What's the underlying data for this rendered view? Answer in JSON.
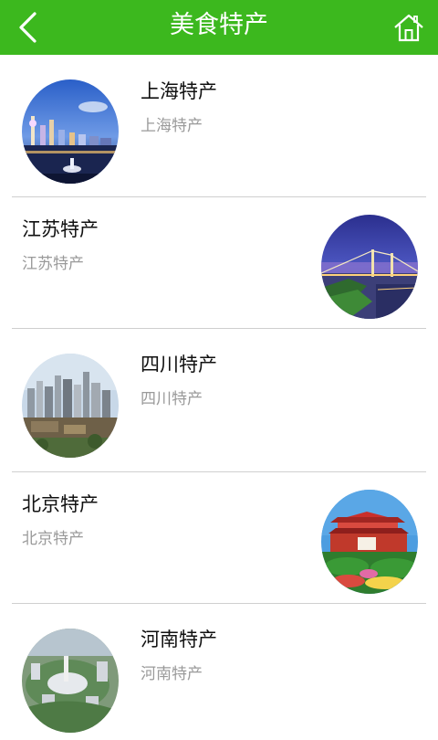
{
  "header": {
    "title": "美食特产",
    "back_icon": "chevron-left-icon",
    "home_icon": "home-icon",
    "bar_color": "#3cb81e"
  },
  "items": [
    {
      "title": "上海特产",
      "subtitle": "上海特产",
      "image": "shanghai-skyline-photo"
    },
    {
      "title": "江苏特产",
      "subtitle": "江苏特产",
      "image": "jiangsu-bridge-photo"
    },
    {
      "title": "四川特产",
      "subtitle": "四川特产",
      "image": "sichuan-city-photo"
    },
    {
      "title": "北京特产",
      "subtitle": "北京特产",
      "image": "beijing-tiananmen-photo"
    },
    {
      "title": "河南特产",
      "subtitle": "河南特产",
      "image": "henan-city-photo"
    }
  ]
}
